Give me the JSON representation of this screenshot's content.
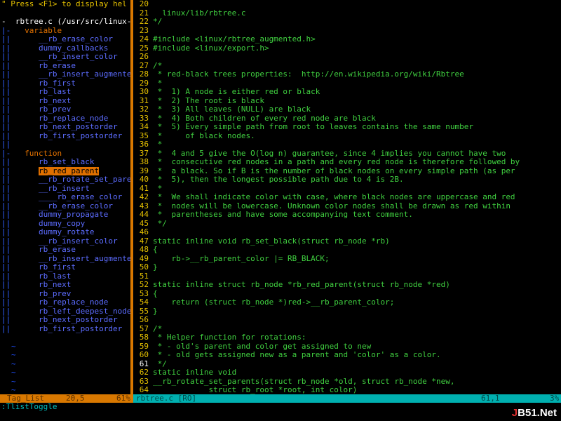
{
  "taglist": {
    "help_line": "\" Press <F1> to display hel",
    "file_line": "-  rbtree.c (/usr/src/linux-so",
    "groups": [
      {
        "header_prefix": "|-   ",
        "name": "variable",
        "items": [
          "__rb_erase_color",
          "dummy_callbacks",
          "__rb_insert_color",
          "rb_erase",
          "__rb_insert_augmented",
          "rb_first",
          "rb_last",
          "rb_next",
          "rb_prev",
          "rb_replace_node",
          "rb_next_postorder",
          "rb_first_postorder"
        ]
      },
      {
        "header_prefix": "|-   ",
        "name": "function",
        "items": [
          "rb_set_black",
          "rb_red_parent",
          "__rb_rotate_set_parents",
          "__rb_insert",
          "____rb_erase_color",
          "__rb_erase_color",
          "dummy_propagate",
          "dummy_copy",
          "dummy_rotate",
          "__rb_insert_color",
          "rb_erase",
          "__rb_insert_augmented",
          "rb_first",
          "rb_last",
          "rb_next",
          "rb_prev",
          "rb_replace_node",
          "rb_left_deepest_node",
          "rb_next_postorder",
          "rb_first_postorder"
        ]
      }
    ],
    "selected_item": "rb_red_parent",
    "item_prefix": "||      ",
    "tildes": [
      "~",
      "~",
      "~",
      "~",
      "~",
      "~"
    ],
    "status": {
      "name": "Tag_List",
      "pos": "20,5",
      "pct": "61%"
    }
  },
  "editor": {
    "current_line": "61",
    "lines": [
      {
        "n": "20",
        "t": ""
      },
      {
        "n": "21",
        "t": "  linux/lib/rbtree.c"
      },
      {
        "n": "22",
        "t": "*/"
      },
      {
        "n": "23",
        "t": ""
      },
      {
        "n": "24",
        "t": "#include <linux/rbtree_augmented.h>"
      },
      {
        "n": "25",
        "t": "#include <linux/export.h>"
      },
      {
        "n": "26",
        "t": ""
      },
      {
        "n": "27",
        "t": "/*"
      },
      {
        "n": "28",
        "t": " * red-black trees properties:  http://en.wikipedia.org/wiki/Rbtree"
      },
      {
        "n": "29",
        "t": " *"
      },
      {
        "n": "30",
        "t": " *  1) A node is either red or black"
      },
      {
        "n": "31",
        "t": " *  2) The root is black"
      },
      {
        "n": "32",
        "t": " *  3) All leaves (NULL) are black"
      },
      {
        "n": "33",
        "t": " *  4) Both children of every red node are black"
      },
      {
        "n": "34",
        "t": " *  5) Every simple path from root to leaves contains the same number"
      },
      {
        "n": "35",
        "t": " *     of black nodes."
      },
      {
        "n": "36",
        "t": " *"
      },
      {
        "n": "37",
        "t": " *  4 and 5 give the O(log n) guarantee, since 4 implies you cannot have two"
      },
      {
        "n": "38",
        "t": " *  consecutive red nodes in a path and every red node is therefore followed by"
      },
      {
        "n": "39",
        "t": " *  a black. So if B is the number of black nodes on every simple path (as per"
      },
      {
        "n": "40",
        "t": " *  5), then the longest possible path due to 4 is 2B."
      },
      {
        "n": "41",
        "t": " *"
      },
      {
        "n": "42",
        "t": " *  We shall indicate color with case, where black nodes are uppercase and red"
      },
      {
        "n": "43",
        "t": " *  nodes will be lowercase. Unknown color nodes shall be drawn as red within"
      },
      {
        "n": "44",
        "t": " *  parentheses and have some accompanying text comment."
      },
      {
        "n": "45",
        "t": " */"
      },
      {
        "n": "46",
        "t": ""
      },
      {
        "n": "47",
        "t": "static inline void rb_set_black(struct rb_node *rb)"
      },
      {
        "n": "48",
        "t": "{"
      },
      {
        "n": "49",
        "t": "    rb->__rb_parent_color |= RB_BLACK;"
      },
      {
        "n": "50",
        "t": "}"
      },
      {
        "n": "51",
        "t": ""
      },
      {
        "n": "52",
        "t": "static inline struct rb_node *rb_red_parent(struct rb_node *red)"
      },
      {
        "n": "53",
        "t": "{"
      },
      {
        "n": "54",
        "t": "    return (struct rb_node *)red->__rb_parent_color;"
      },
      {
        "n": "55",
        "t": "}"
      },
      {
        "n": "56",
        "t": ""
      },
      {
        "n": "57",
        "t": "/*"
      },
      {
        "n": "58",
        "t": " * Helper function for rotations:"
      },
      {
        "n": "59",
        "t": " * - old's parent and color get assigned to new"
      },
      {
        "n": "60",
        "t": " * - old gets assigned new as a parent and 'color' as a color."
      },
      {
        "n": "61",
        "t": " */"
      },
      {
        "n": "62",
        "t": "static inline void"
      },
      {
        "n": "63",
        "t": "__rb_rotate_set_parents(struct rb_node *old, struct rb_node *new,"
      },
      {
        "n": "64",
        "t": "            struct rb_root *root, int color)"
      }
    ],
    "status": {
      "name": "rbtree.c [RO]",
      "pos": "61,1",
      "pct": "3%"
    }
  },
  "cmdline": ":TlistToggle",
  "watermark": {
    "prefix": "J",
    "rest": "B51.Net"
  },
  "colors": {
    "line_number": "#e4c000",
    "text": "#40d040",
    "tag": "#5c6cff",
    "kind": "#e07000",
    "status_left": "#d97800",
    "status_right": "#00b0b0"
  }
}
